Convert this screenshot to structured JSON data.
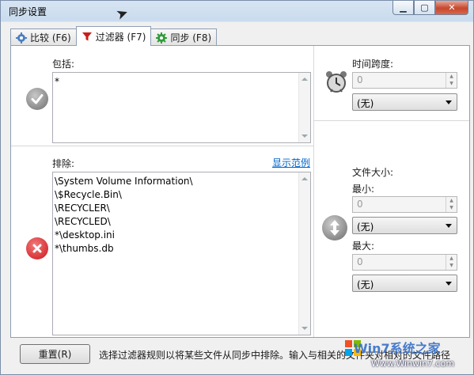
{
  "window": {
    "title": "同步设置"
  },
  "tabs": [
    {
      "label": "比较 (F6)",
      "icon": "gear-icon",
      "active": false
    },
    {
      "label": "过滤器 (F7)",
      "icon": "filter-icon",
      "active": true
    },
    {
      "label": "同步 (F8)",
      "icon": "gear-green-icon",
      "active": false
    }
  ],
  "include": {
    "label": "包括:",
    "value": "*"
  },
  "exclude": {
    "label": "排除:",
    "show_example": "显示范例",
    "lines": [
      "\\System Volume Information\\",
      "\\$Recycle.Bin\\",
      "\\RECYCLER\\",
      "\\RECYCLED\\",
      "*\\desktop.ini",
      "*\\thumbs.db"
    ]
  },
  "time_span": {
    "label": "时间跨度:",
    "value": "0",
    "unit": "(无)"
  },
  "file_size": {
    "label": "文件大小:",
    "min_label": "最小:",
    "min_value": "0",
    "min_unit": "(无)",
    "max_label": "最大:",
    "max_value": "0",
    "max_unit": "(无)"
  },
  "footer": {
    "reset_label": "重置(R)",
    "hint": "选择过滤器规则以将某些文件从同步中排除。输入与相关的文件夹对相对的文件路径",
    "watermark_brand": "Win7系统之家",
    "watermark_url": "Www.Winwin7.com"
  },
  "colors": {
    "link": "#0066cc",
    "close": "#c6472d",
    "check": "#6e6e6e",
    "cross": "#d8262a"
  }
}
